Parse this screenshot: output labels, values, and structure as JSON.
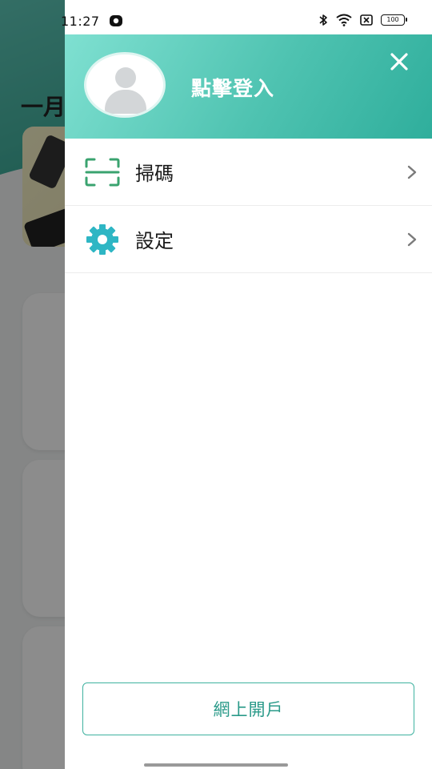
{
  "status_bar": {
    "time": "11:27",
    "battery": "100"
  },
  "background": {
    "title_partial": "一月"
  },
  "drawer": {
    "header": {
      "login_label": "點擊登入"
    },
    "menu": [
      {
        "id": "scan",
        "label": "掃碼",
        "icon": "scan-icon"
      },
      {
        "id": "settings",
        "label": "設定",
        "icon": "gear-icon"
      }
    ],
    "open_account_label": "網上開戶"
  },
  "colors": {
    "accent": "#3fb2a0",
    "header_start": "#7fe0d1",
    "header_end": "#2fae9c",
    "scan_icon": "#3aa36f",
    "gear_icon": "#2eb6c4"
  }
}
